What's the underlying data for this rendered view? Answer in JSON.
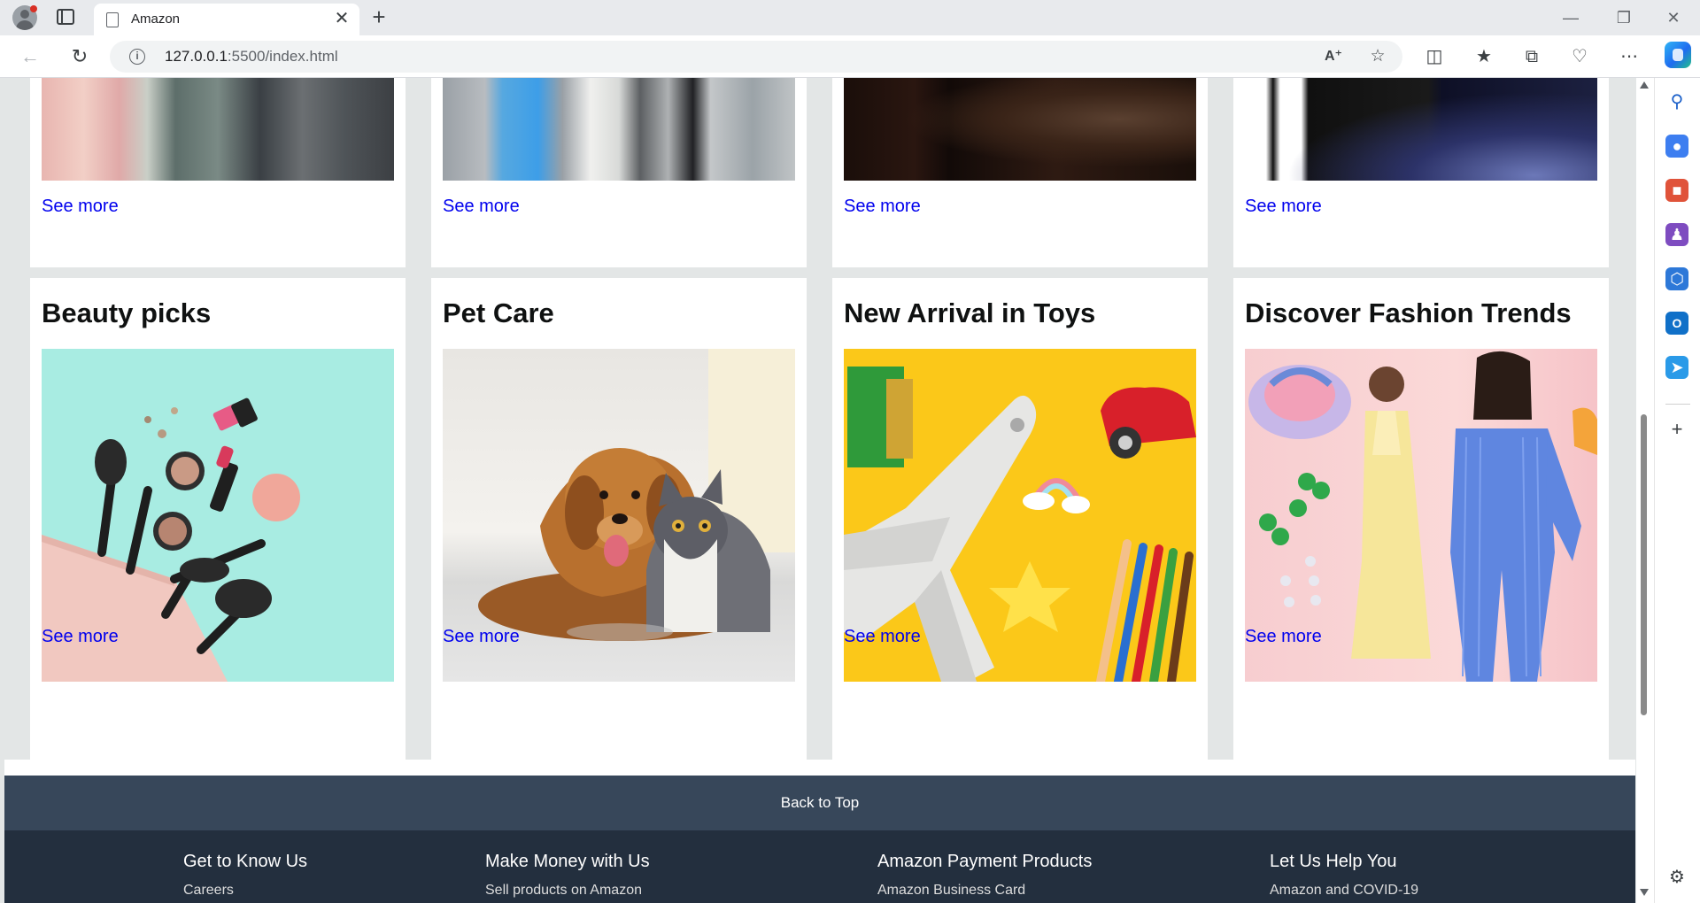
{
  "browser": {
    "tab_title": "Amazon",
    "url_host": "127.0.0.1",
    "url_rest": ":5500/index.html",
    "new_tab_label": "+",
    "close_tab_label": "✕"
  },
  "cards_top": [
    {
      "see_more": "See more",
      "image": "fashion-fabrics-thumbnail"
    },
    {
      "see_more": "See more",
      "image": "home-bottles-thumbnail"
    },
    {
      "see_more": "See more",
      "image": "furniture-chair-thumbnail"
    },
    {
      "see_more": "See more",
      "image": "samsung-phone-thumbnail"
    }
  ],
  "cards": [
    {
      "title": "Beauty picks",
      "see_more": "See more",
      "image": "makeup-cosmetics"
    },
    {
      "title": "Pet Care",
      "see_more": "See more",
      "image": "dog-and-cat"
    },
    {
      "title": "New Arrival in Toys",
      "see_more": "See more",
      "image": "toy-airplane-car-pencils"
    },
    {
      "title": "Discover Fashion Trends",
      "see_more": "See more",
      "image": "fashion-models"
    }
  ],
  "back_to_top": "Back to Top",
  "footer": {
    "columns": [
      {
        "heading": "Get to Know Us",
        "first_link": "Careers"
      },
      {
        "heading": "Make Money with Us",
        "first_link": "Sell products on Amazon"
      },
      {
        "heading": "Amazon Payment Products",
        "first_link": "Amazon Business Card"
      },
      {
        "heading": "Let Us Help You",
        "first_link": "Amazon and COVID-19"
      }
    ]
  },
  "colors": {
    "page_bg": "#e3e6e6",
    "back_to_top_bg": "#37475a",
    "footer_bg": "#232f3e",
    "link": "#0000ee"
  }
}
